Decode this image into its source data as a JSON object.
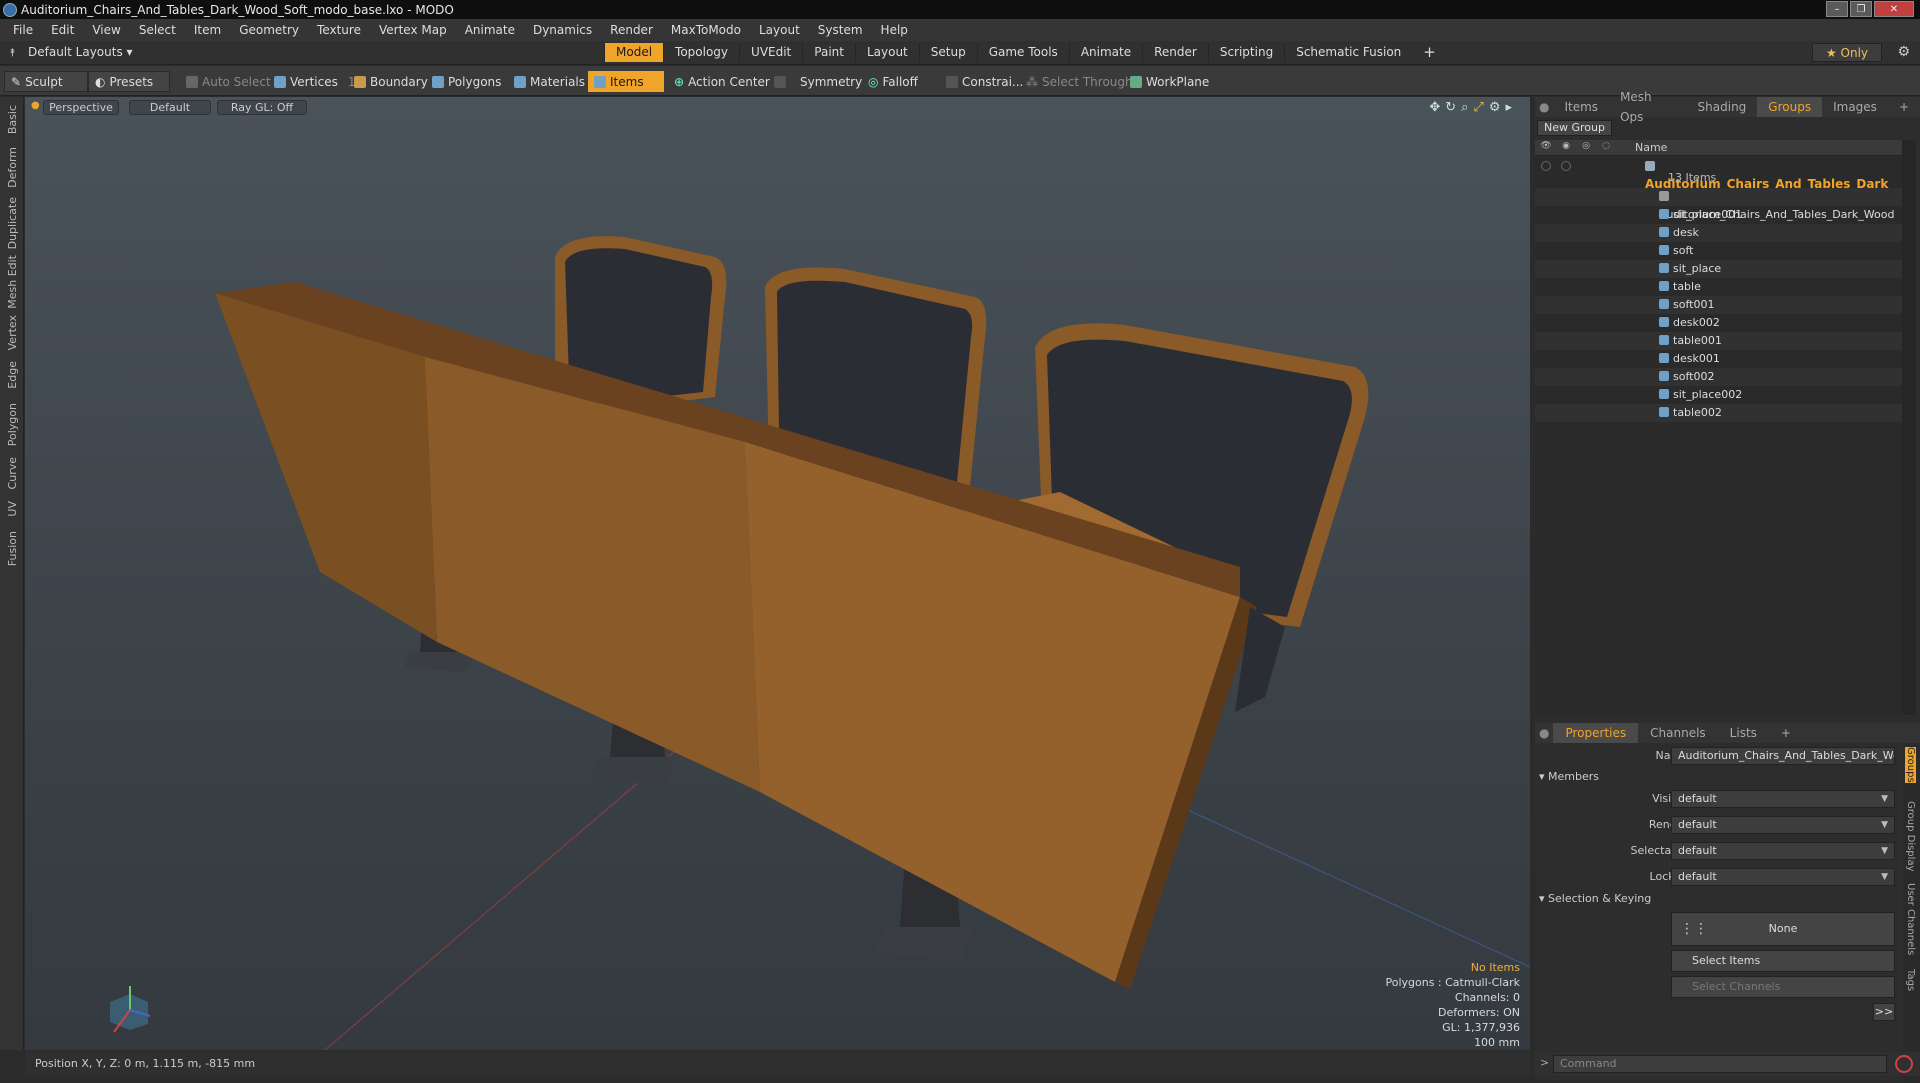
{
  "window": {
    "title": "Auditorium_Chairs_And_Tables_Dark_Wood_Soft_modo_base.lxo - MODO"
  },
  "menu": [
    "File",
    "Edit",
    "View",
    "Select",
    "Item",
    "Geometry",
    "Texture",
    "Vertex Map",
    "Animate",
    "Dynamics",
    "Render",
    "MaxToModo",
    "Layout",
    "System",
    "Help"
  ],
  "layout": {
    "default_layouts": "Default Layouts ▾",
    "tabs": [
      "Model",
      "Topology",
      "UVEdit",
      "Paint",
      "Layout",
      "Setup",
      "Game Tools",
      "Animate",
      "Render",
      "Scripting",
      "Schematic Fusion"
    ],
    "active_tab": "Model",
    "only_label": "★  Only"
  },
  "toolbar": {
    "sculpt": "Sculpt",
    "presets": "Presets",
    "auto_select": "Auto Select",
    "vertices": "Vertices",
    "vertices_count": "1",
    "boundary": "Boundary",
    "polygons": "Polygons",
    "materials": "Materials",
    "items": "Items",
    "action_center": "Action Center",
    "symmetry": "Symmetry",
    "falloff": "Falloff",
    "constraints": "Constrai...",
    "select_through": "Select Through",
    "workplane": "WorkPlane"
  },
  "left_tabs": [
    "Basic",
    "Deform",
    "Duplicate",
    "Mesh Edit",
    "Vertex",
    "Edge",
    "Polygon",
    "Curve",
    "UV",
    "Fusion"
  ],
  "viewport": {
    "view": "Perspective",
    "shading": "Default",
    "raygl": "Ray GL: Off",
    "info": {
      "selection": "No Items",
      "polygons": "Polygons : Catmull-Clark",
      "channels": "Channels: 0",
      "deformers": "Deformers: ON",
      "gl": "GL: 1,377,936",
      "scale": "100 mm"
    },
    "colors": {
      "wood": "#8a5a28",
      "wood_dark": "#6b4220",
      "seat": "#2a2d33",
      "grid_red": "#a04040",
      "grid_blue": "#4060a0"
    }
  },
  "status": {
    "position": "Position X, Y, Z:  0 m, 1.115 m, -815 mm"
  },
  "item_panel": {
    "tabs": [
      "Items",
      "Mesh Ops",
      "Shading",
      "Groups",
      "Images"
    ],
    "active_tab": "Groups",
    "new_group": "New Group",
    "column_name": "Name",
    "group_name": "Auditorium_Chairs_And_Tables_Dark_ ...",
    "group_count": "13 Items",
    "items": [
      "Auditorium_Chairs_And_Tables_Dark_Wood ...",
      "sit_place001",
      "desk",
      "soft",
      "sit_place",
      "table",
      "soft001",
      "desk002",
      "table001",
      "desk001",
      "soft002",
      "sit_place002",
      "table002"
    ]
  },
  "properties": {
    "tabs": [
      "Properties",
      "Channels",
      "Lists"
    ],
    "active_tab": "Properties",
    "name_label": "Name",
    "name_value": "Auditorium_Chairs_And_Tables_Dark_Wooc",
    "members_section": "Members",
    "visible_label": "Visible",
    "visible_value": "default",
    "render_label": "Render",
    "render_value": "default",
    "selectable_label": "Selectable",
    "selectable_value": "default",
    "locked_label": "Locked",
    "locked_value": "default",
    "selection_section": "Selection & Keying",
    "none_btn": "None",
    "select_items": "Select Items",
    "select_channels": "Select Channels",
    "more": ">>",
    "side_tabs": [
      "Groups",
      "Group Display",
      "User Channels",
      "Tags"
    ]
  },
  "command": {
    "placeholder": "Command"
  }
}
